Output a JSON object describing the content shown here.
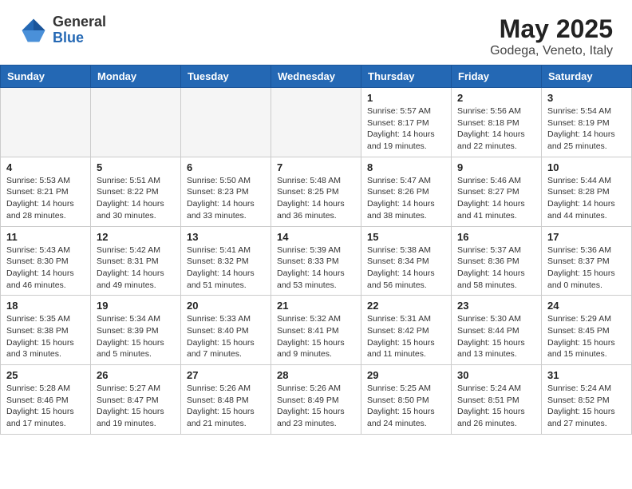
{
  "header": {
    "logo_general": "General",
    "logo_blue": "Blue",
    "month_year": "May 2025",
    "location": "Godega, Veneto, Italy"
  },
  "days_of_week": [
    "Sunday",
    "Monday",
    "Tuesday",
    "Wednesday",
    "Thursday",
    "Friday",
    "Saturday"
  ],
  "weeks": [
    [
      {
        "day": "",
        "info": ""
      },
      {
        "day": "",
        "info": ""
      },
      {
        "day": "",
        "info": ""
      },
      {
        "day": "",
        "info": ""
      },
      {
        "day": "1",
        "info": "Sunrise: 5:57 AM\nSunset: 8:17 PM\nDaylight: 14 hours\nand 19 minutes."
      },
      {
        "day": "2",
        "info": "Sunrise: 5:56 AM\nSunset: 8:18 PM\nDaylight: 14 hours\nand 22 minutes."
      },
      {
        "day": "3",
        "info": "Sunrise: 5:54 AM\nSunset: 8:19 PM\nDaylight: 14 hours\nand 25 minutes."
      }
    ],
    [
      {
        "day": "4",
        "info": "Sunrise: 5:53 AM\nSunset: 8:21 PM\nDaylight: 14 hours\nand 28 minutes."
      },
      {
        "day": "5",
        "info": "Sunrise: 5:51 AM\nSunset: 8:22 PM\nDaylight: 14 hours\nand 30 minutes."
      },
      {
        "day": "6",
        "info": "Sunrise: 5:50 AM\nSunset: 8:23 PM\nDaylight: 14 hours\nand 33 minutes."
      },
      {
        "day": "7",
        "info": "Sunrise: 5:48 AM\nSunset: 8:25 PM\nDaylight: 14 hours\nand 36 minutes."
      },
      {
        "day": "8",
        "info": "Sunrise: 5:47 AM\nSunset: 8:26 PM\nDaylight: 14 hours\nand 38 minutes."
      },
      {
        "day": "9",
        "info": "Sunrise: 5:46 AM\nSunset: 8:27 PM\nDaylight: 14 hours\nand 41 minutes."
      },
      {
        "day": "10",
        "info": "Sunrise: 5:44 AM\nSunset: 8:28 PM\nDaylight: 14 hours\nand 44 minutes."
      }
    ],
    [
      {
        "day": "11",
        "info": "Sunrise: 5:43 AM\nSunset: 8:30 PM\nDaylight: 14 hours\nand 46 minutes."
      },
      {
        "day": "12",
        "info": "Sunrise: 5:42 AM\nSunset: 8:31 PM\nDaylight: 14 hours\nand 49 minutes."
      },
      {
        "day": "13",
        "info": "Sunrise: 5:41 AM\nSunset: 8:32 PM\nDaylight: 14 hours\nand 51 minutes."
      },
      {
        "day": "14",
        "info": "Sunrise: 5:39 AM\nSunset: 8:33 PM\nDaylight: 14 hours\nand 53 minutes."
      },
      {
        "day": "15",
        "info": "Sunrise: 5:38 AM\nSunset: 8:34 PM\nDaylight: 14 hours\nand 56 minutes."
      },
      {
        "day": "16",
        "info": "Sunrise: 5:37 AM\nSunset: 8:36 PM\nDaylight: 14 hours\nand 58 minutes."
      },
      {
        "day": "17",
        "info": "Sunrise: 5:36 AM\nSunset: 8:37 PM\nDaylight: 15 hours\nand 0 minutes."
      }
    ],
    [
      {
        "day": "18",
        "info": "Sunrise: 5:35 AM\nSunset: 8:38 PM\nDaylight: 15 hours\nand 3 minutes."
      },
      {
        "day": "19",
        "info": "Sunrise: 5:34 AM\nSunset: 8:39 PM\nDaylight: 15 hours\nand 5 minutes."
      },
      {
        "day": "20",
        "info": "Sunrise: 5:33 AM\nSunset: 8:40 PM\nDaylight: 15 hours\nand 7 minutes."
      },
      {
        "day": "21",
        "info": "Sunrise: 5:32 AM\nSunset: 8:41 PM\nDaylight: 15 hours\nand 9 minutes."
      },
      {
        "day": "22",
        "info": "Sunrise: 5:31 AM\nSunset: 8:42 PM\nDaylight: 15 hours\nand 11 minutes."
      },
      {
        "day": "23",
        "info": "Sunrise: 5:30 AM\nSunset: 8:44 PM\nDaylight: 15 hours\nand 13 minutes."
      },
      {
        "day": "24",
        "info": "Sunrise: 5:29 AM\nSunset: 8:45 PM\nDaylight: 15 hours\nand 15 minutes."
      }
    ],
    [
      {
        "day": "25",
        "info": "Sunrise: 5:28 AM\nSunset: 8:46 PM\nDaylight: 15 hours\nand 17 minutes."
      },
      {
        "day": "26",
        "info": "Sunrise: 5:27 AM\nSunset: 8:47 PM\nDaylight: 15 hours\nand 19 minutes."
      },
      {
        "day": "27",
        "info": "Sunrise: 5:26 AM\nSunset: 8:48 PM\nDaylight: 15 hours\nand 21 minutes."
      },
      {
        "day": "28",
        "info": "Sunrise: 5:26 AM\nSunset: 8:49 PM\nDaylight: 15 hours\nand 23 minutes."
      },
      {
        "day": "29",
        "info": "Sunrise: 5:25 AM\nSunset: 8:50 PM\nDaylight: 15 hours\nand 24 minutes."
      },
      {
        "day": "30",
        "info": "Sunrise: 5:24 AM\nSunset: 8:51 PM\nDaylight: 15 hours\nand 26 minutes."
      },
      {
        "day": "31",
        "info": "Sunrise: 5:24 AM\nSunset: 8:52 PM\nDaylight: 15 hours\nand 27 minutes."
      }
    ]
  ]
}
